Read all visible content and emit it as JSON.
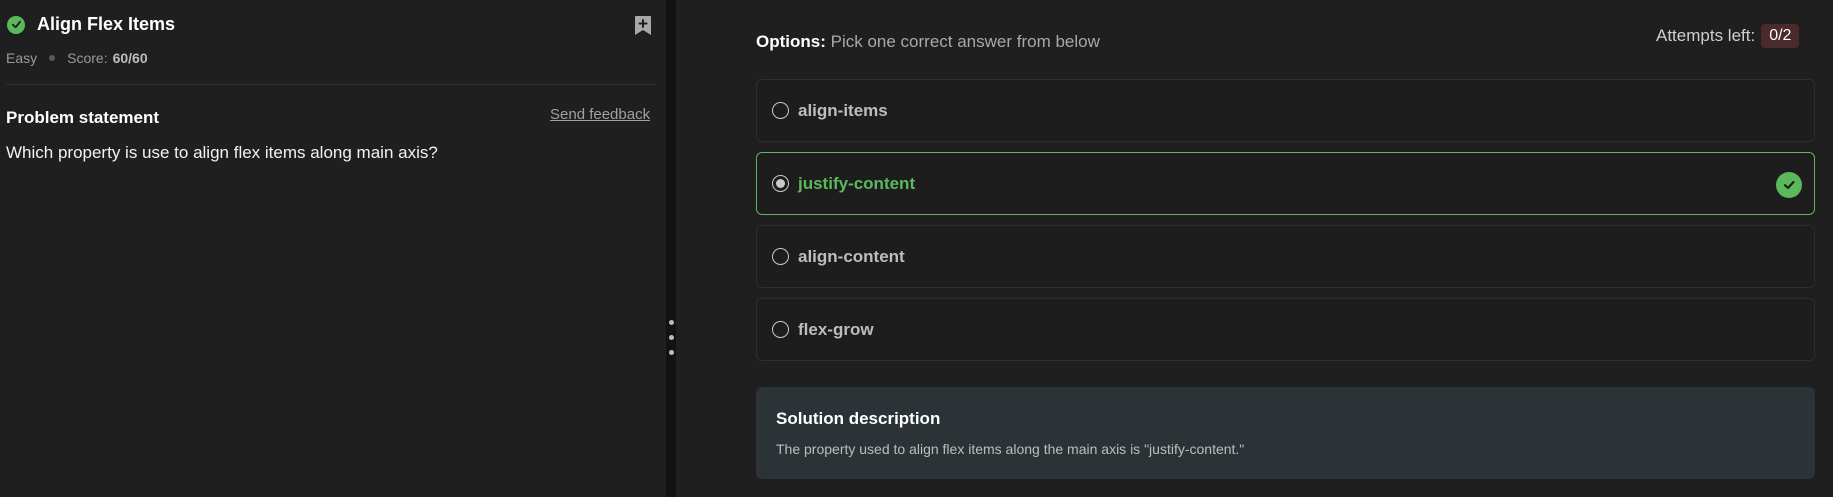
{
  "problem": {
    "title": "Align Flex Items",
    "difficulty": "Easy",
    "score_label": "Score:",
    "score_value": "60/60",
    "statement_heading": "Problem statement",
    "send_feedback": "Send feedback",
    "statement": "Which property is use to align flex items along main axis?"
  },
  "options_header": {
    "label": "Options:",
    "hint": "Pick one correct answer from below",
    "attempts_label": "Attempts left:",
    "attempts_value": "0/2"
  },
  "options": [
    {
      "label": "align-items",
      "selected": false
    },
    {
      "label": "justify-content",
      "selected": true,
      "correct": true
    },
    {
      "label": "align-content",
      "selected": false
    },
    {
      "label": "flex-grow",
      "selected": false
    }
  ],
  "solution": {
    "title": "Solution description",
    "text": "The property used to align flex items along the main axis is \"justify-content.\""
  },
  "colors": {
    "accent_green": "#5cb85c",
    "badge_bg": "#4a2a2a",
    "solution_bg": "#2c3336"
  },
  "icons": [
    "check-circle-icon",
    "bookmark-add-icon",
    "radio-icon",
    "drag-handle-icon"
  ]
}
